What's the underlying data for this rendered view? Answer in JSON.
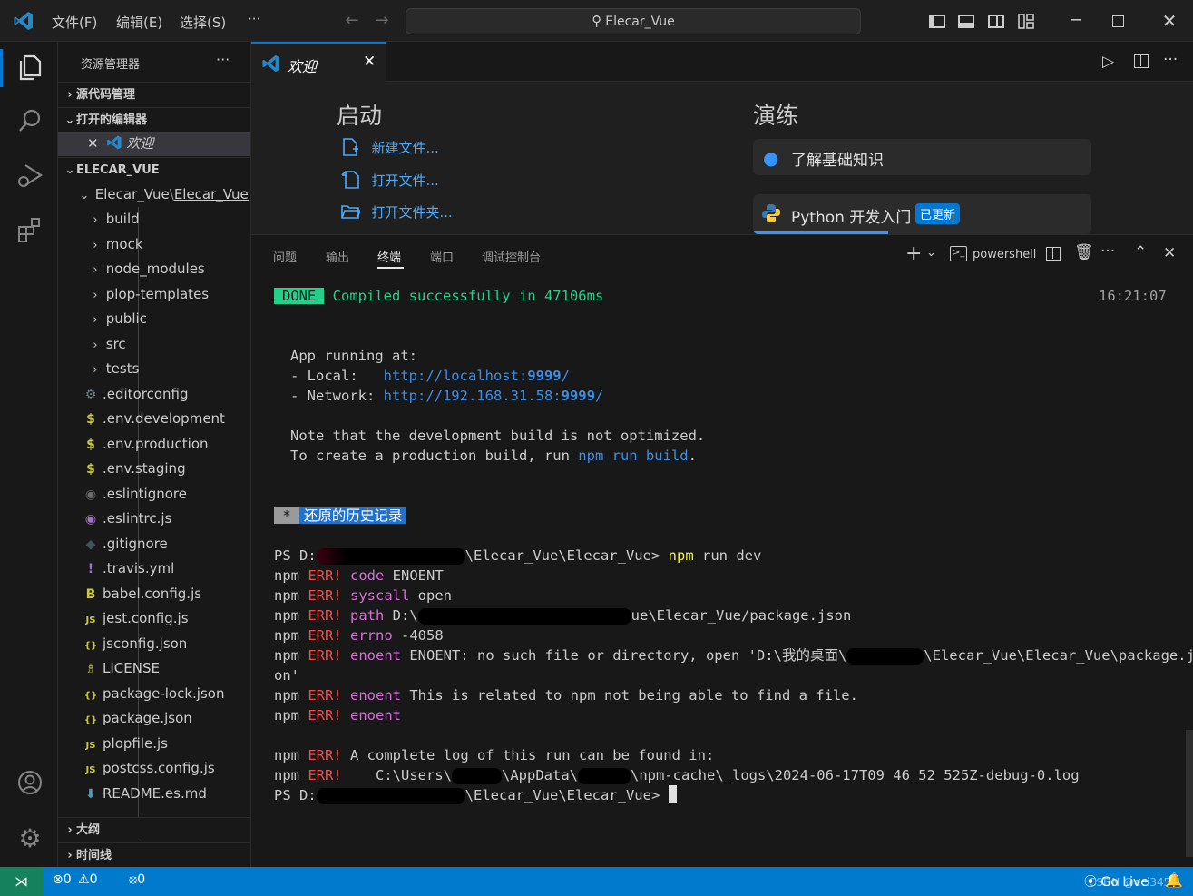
{
  "titlebar": {
    "menus": [
      "文件(F)",
      "编辑(E)",
      "选择(S)",
      "···"
    ],
    "search_label": "Elecar_Vue"
  },
  "sidebar": {
    "title": "资源管理器",
    "more": "···",
    "sections": {
      "source_control": "源代码管理",
      "open_editors": "打开的编辑器",
      "project": "ELECAR_VUE",
      "outline": "大纲",
      "timeline": "时间线"
    },
    "open_editor_item": "欢迎",
    "breadcrumb_folder": "Elecar_Vue",
    "breadcrumb_sep": "\\",
    "breadcrumb_sub": "Elecar_Vue",
    "folders": [
      "build",
      "mock",
      "node_modules",
      "plop-templates",
      "public",
      "src",
      "tests"
    ],
    "files": [
      {
        "name": ".editorconfig",
        "icon": "⚙",
        "color": "#6d8086"
      },
      {
        "name": ".env.development",
        "icon": "$",
        "color": "#cbcb41"
      },
      {
        "name": ".env.production",
        "icon": "$",
        "color": "#cbcb41"
      },
      {
        "name": ".env.staging",
        "icon": "$",
        "color": "#cbcb41"
      },
      {
        "name": ".eslintignore",
        "icon": "◉",
        "color": "#6d6d6d"
      },
      {
        "name": ".eslintrc.js",
        "icon": "◉",
        "color": "#a074c4"
      },
      {
        "name": ".gitignore",
        "icon": "◆",
        "color": "#41535b"
      },
      {
        "name": ".travis.yml",
        "icon": "!",
        "color": "#a074c4"
      },
      {
        "name": "babel.config.js",
        "icon": "B",
        "color": "#cbcb41"
      },
      {
        "name": "jest.config.js",
        "icon": "JS",
        "color": "#cbcb41"
      },
      {
        "name": "jsconfig.json",
        "icon": "{}",
        "color": "#cbcb41"
      },
      {
        "name": "LICENSE",
        "icon": "♗",
        "color": "#cbcb41"
      },
      {
        "name": "package-lock.json",
        "icon": "{}",
        "color": "#cbcb41"
      },
      {
        "name": "package.json",
        "icon": "{}",
        "color": "#cbcb41"
      },
      {
        "name": "plopfile.js",
        "icon": "JS",
        "color": "#cbcb41"
      },
      {
        "name": "postcss.config.js",
        "icon": "JS",
        "color": "#cbcb41"
      },
      {
        "name": "README.es.md",
        "icon": "⬇",
        "color": "#519aba"
      }
    ]
  },
  "editor": {
    "tab_label": "欢迎",
    "start_heading": "启动",
    "start_links": [
      "新建文件...",
      "打开文件...",
      "打开文件夹..."
    ],
    "walkthrough_heading": "演练",
    "walkthroughs": [
      "了解基础知识",
      "Python 开发入门"
    ],
    "updated_badge": "已更新"
  },
  "panel": {
    "tabs": [
      "问题",
      "输出",
      "终端",
      "端口",
      "调试控制台"
    ],
    "active_tab": "终端",
    "shell_name": "powershell",
    "terminal": {
      "done_badge": "DONE",
      "compiled": "Compiled successfully in 47106ms",
      "time": "16:21:07",
      "app_running": "App running at:",
      "local_label": "- Local:   ",
      "local_url_pre": "http://localhost:",
      "local_port": "9999",
      "network_label": "- Network: ",
      "network_url_pre": "http://192.168.31.58:",
      "network_port": "9999",
      "note1": "Note that the development build is not optimized.",
      "note2_pre": "To create a production build, run ",
      "note2_cmd": "npm run build",
      "note2_post": ".",
      "restore_star": " * ",
      "restore_label": " 还原的历史记录 ",
      "ps_prefix": "PS D:",
      "ps_path_tail": "\\Elecar_Vue\\Elecar_Vue>",
      "cmd_npm": "npm",
      "cmd_rest": " run dev",
      "err_lines": [
        {
          "key": "code",
          "val": " ENOENT"
        },
        {
          "key": "syscall",
          "val": " open"
        },
        {
          "key": "path",
          "val": " D:\\",
          "tail": "ue\\Elecar_Vue/package.json"
        },
        {
          "key": "errno",
          "val": " -4058"
        },
        {
          "key": "enoent",
          "val": " ENOENT: no such file or directory, open 'D:\\我的桌面\\",
          "tail": "\\Elecar_Vue\\Elecar_Vue\\package.js"
        },
        {
          "key": "",
          "val": "on'"
        },
        {
          "key": "enoent",
          "val": " This is related to npm not being able to find a file."
        },
        {
          "key": "enoent",
          "val": ""
        }
      ],
      "npm_label": "npm",
      "err_label": "ERR!",
      "log_line": " A complete log of this run can be found in:",
      "log_path_pre": "    C:\\Users\\",
      "log_path_mid": "\\AppData\\",
      "log_path_tail": "\\npm-cache\\_logs\\2024-06-17T09_46_52_525Z-debug-0.log",
      "final_prompt": "\\Elecar_Vue\\Elecar_Vue>"
    }
  },
  "statusbar": {
    "errors": "0",
    "warnings": "0",
    "ports": "0",
    "golive": "Go Live",
    "watermark": "CSDN @eci3459"
  }
}
